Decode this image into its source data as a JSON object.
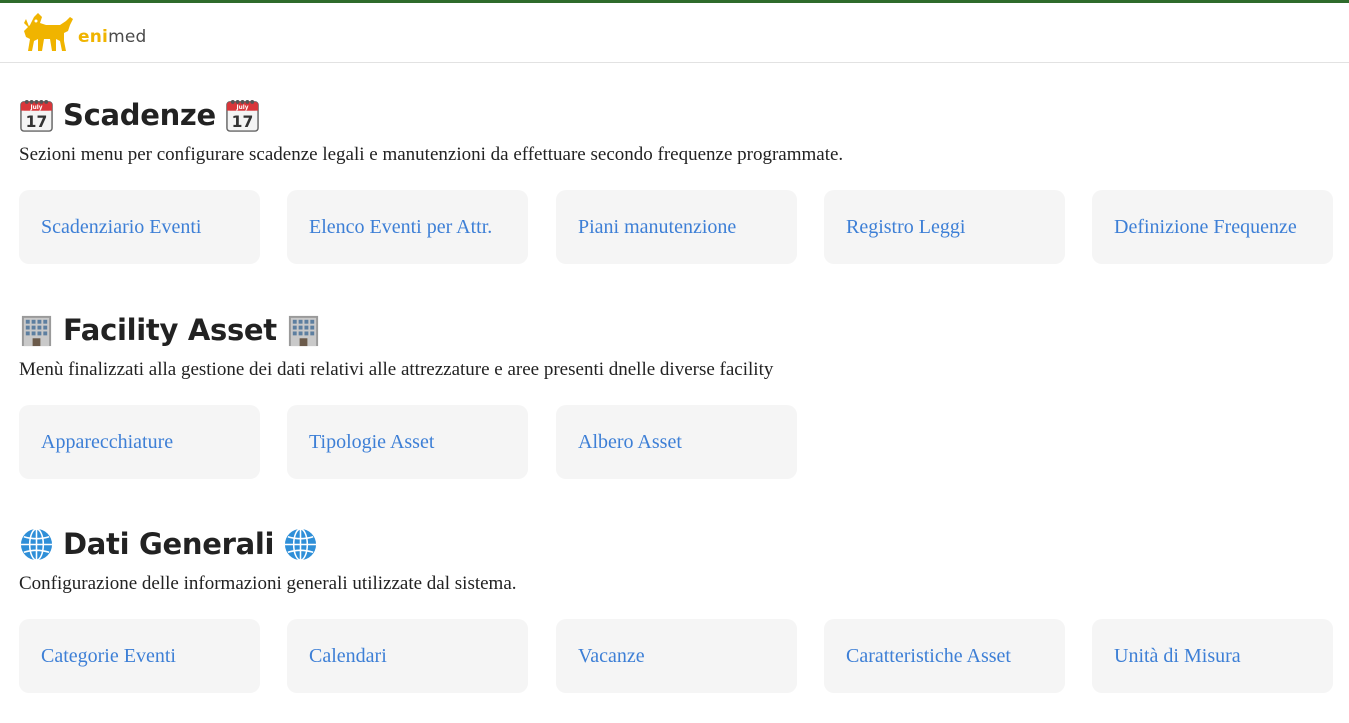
{
  "header": {
    "brand_eni": "eni",
    "brand_med": "med"
  },
  "sections": [
    {
      "title": "Scadenze",
      "description": "Sezioni menu per configurare scadenze legali e manutenzioni da effettuare secondo frequenze programmate.",
      "icon": "calendar-icon",
      "cards": [
        "Scadenziario Eventi",
        "Elenco Eventi per Attr.",
        "Piani manutenzione",
        "Registro Leggi",
        "Definizione Frequenze"
      ]
    },
    {
      "title": "Facility Asset",
      "description": "Menù finalizzati alla gestione dei dati relativi alle attrezzature e aree presenti dnelle diverse facility",
      "icon": "office-building-icon",
      "cards": [
        "Apparecchiature",
        "Tipologie Asset",
        "Albero Asset"
      ]
    },
    {
      "title": "Dati Generali",
      "description": "Configurazione delle informazioni generali utilizzate dal sistema.",
      "icon": "globe-icon",
      "cards": [
        "Categorie Eventi",
        "Calendari",
        "Vacanze",
        "Caratteristiche Asset",
        "Unità di Misura"
      ]
    }
  ],
  "colors": {
    "top_bar": "#2e6b2b",
    "link": "#3d7fd6",
    "card_bg": "#f5f5f5",
    "brand_yellow": "#f0b400"
  }
}
